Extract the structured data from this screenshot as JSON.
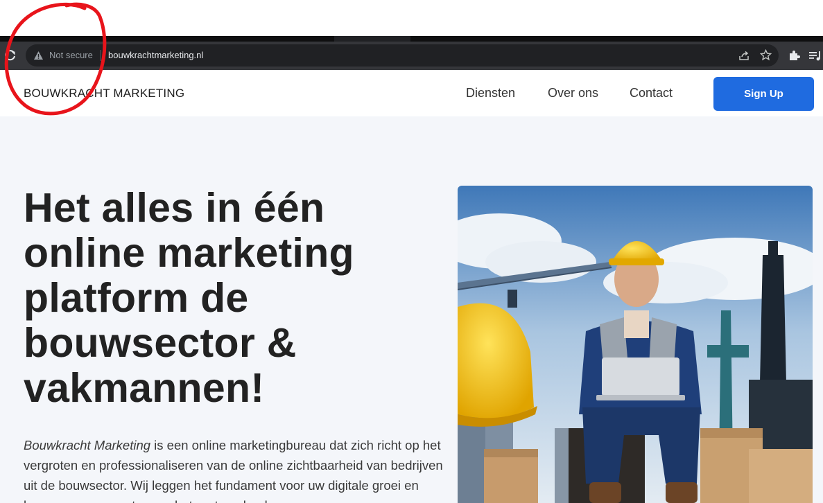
{
  "browser": {
    "not_secure_label": "Not secure",
    "url": "bouwkrachtmarketing.nl",
    "icons": [
      "reload-icon",
      "warning-icon",
      "share-icon",
      "star-icon",
      "extensions-icon",
      "media-control-icon"
    ]
  },
  "header": {
    "brand": "BOUWKRACHT MARKETING",
    "nav": [
      "Diensten",
      "Over ons",
      "Contact"
    ],
    "signup_label": "Sign Up"
  },
  "hero": {
    "headline": "Het alles in één online marketing platform de bouwsector & vakmannen!",
    "intro_brand": "Bouwkracht Marketing",
    "intro_text": " is een online marketingbureau dat zich richt op het vergroten en professionaliseren van de online zichtbaarheid van bedrijven uit de bouwsector. Wij leggen het fundament voor uw digitale groei en bouwen samen met u aan het grote geheel."
  },
  "colors": {
    "accent": "#1f6be0",
    "hero_background": "#f4f6fa",
    "annotation": "#e8141b"
  }
}
